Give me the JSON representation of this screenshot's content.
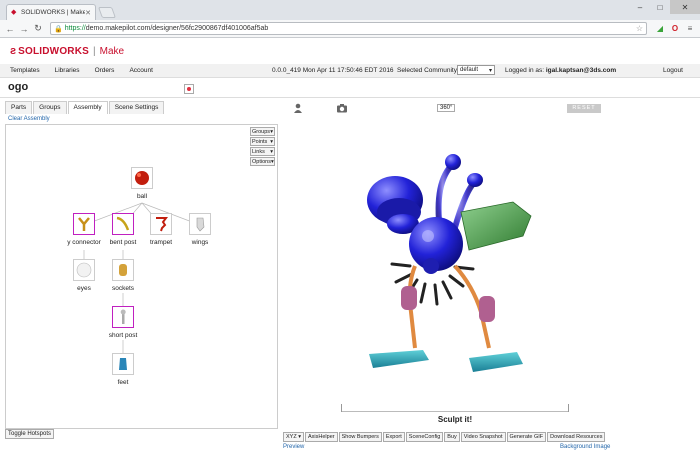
{
  "browser": {
    "tab_title": "SOLIDWORKS | Make",
    "url_scheme": "https://",
    "url_rest": "demo.makepilot.com/designer/56fc2900867df401006af5ab"
  },
  "brand": {
    "solidworks": "SOLIDWORKS",
    "sep": "|",
    "make": "Make",
    "color": "#c8102e"
  },
  "menu": {
    "items": [
      "Templates",
      "Libraries",
      "Orders",
      "Account"
    ],
    "version": "0.0.0_419 Mon Apr 11 17:50:46 EDT 2016",
    "community_label": "Selected Community:",
    "community_value": "default",
    "login_label": "Logged in as:",
    "login_user": "igal.kaptsan@3ds.com",
    "logout": "Logout"
  },
  "design_name": "ogo",
  "left": {
    "tabs": [
      "Parts",
      "Groups",
      "Assembly",
      "Scene Settings"
    ],
    "active_tab": "Assembly",
    "clear": "Clear Assembly",
    "dropdowns": [
      "Groups",
      "Points",
      "Links",
      "Options"
    ],
    "nodes": {
      "ball": "ball",
      "y_connector": "y connector",
      "bent_post": "bent post",
      "trampet": "trampet",
      "wings": "wings",
      "eyes": "eyes",
      "sockets": "sockets",
      "short_post": "short post",
      "feet": "feet"
    },
    "toggle": "Toggle Hotspots"
  },
  "right": {
    "deg": "360°",
    "reset": "RESET",
    "sculpt": "Sculpt it!",
    "xyz": "XYZ",
    "buttons": [
      "AxisHelper",
      "Show Bumpers",
      "Export",
      "SceneConfig",
      "Buy",
      "Video Snapshot",
      "Generate GIF",
      "Download Resources"
    ],
    "preview": "Preview",
    "background": "Background Image"
  }
}
